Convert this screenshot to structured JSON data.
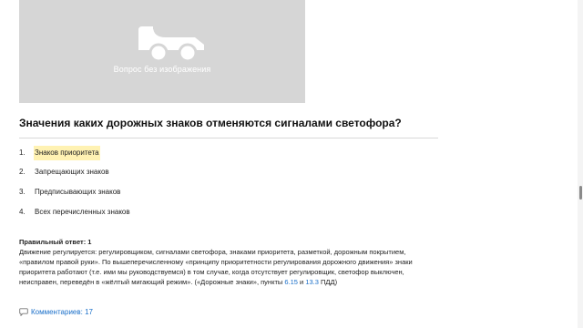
{
  "image_placeholder": {
    "label": "Вопрос без изображения",
    "icon": "car-icon"
  },
  "question": {
    "text": "Значения каких дорожных знаков отменяются сигналами светофора?"
  },
  "answers": [
    {
      "number": "1.",
      "text": "Знаков приоритета",
      "highlighted": true
    },
    {
      "number": "2.",
      "text": "Запрещающих знаков",
      "highlighted": false
    },
    {
      "number": "3.",
      "text": "Предписывающих знаков",
      "highlighted": false
    },
    {
      "number": "4.",
      "text": "Всех перечисленных знаков",
      "highlighted": false
    }
  ],
  "correct_answer": {
    "label": "Правильный ответ: 1",
    "explanation_before": "Движение регулируется: регулировщиком, сигналами светофора, знаками приоритета, разметкой, дорожным покрытием, «правилом правой руки». По вышеперечисленному «принципу приоритетности регулирования дорожного движения» знаки приоритета работают (т.е. ими мы руководствуемся) в том случае, когда отсутствует регулировщик, светофор выключен, неисправен, переведён в «жёлтый мигающий режим». («Дорожные знаки», пункты ",
    "link1": "6.15",
    "between": " и ",
    "link2": "13.3",
    "after": " ПДД)"
  },
  "comments": {
    "label": "Комментариев: 17",
    "icon": "comment-icon"
  },
  "colors": {
    "highlight": "#fff2b3",
    "link": "#1a6fc9",
    "placeholder_bg": "#d6d6d6"
  }
}
